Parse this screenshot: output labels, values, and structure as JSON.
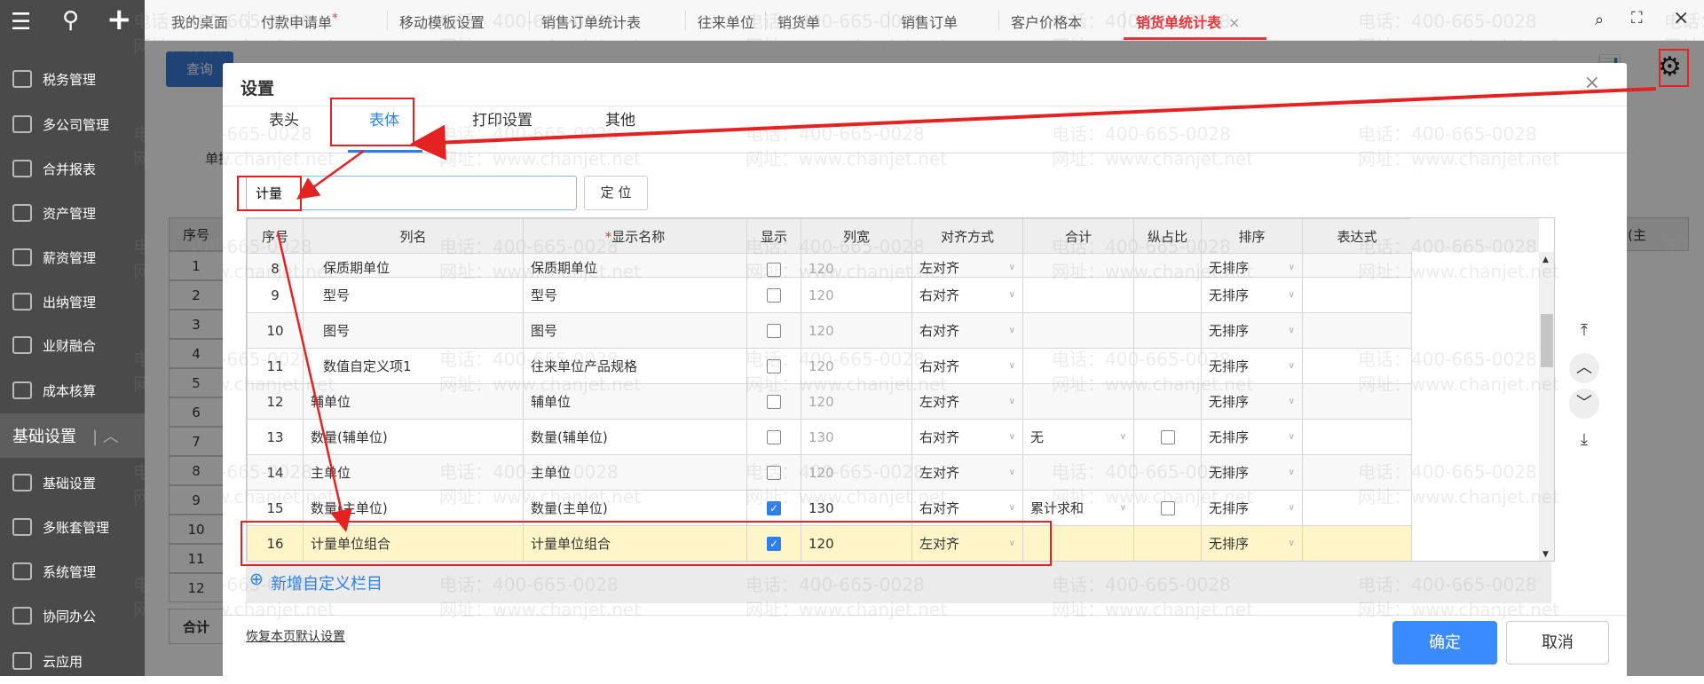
{
  "sidebar": {
    "top_icons": [
      "menu-icon",
      "search-icon",
      "plus-icon"
    ],
    "items": [
      "税务管理",
      "多公司管理",
      "合并报表",
      "资产管理",
      "薪资管理",
      "出纳管理",
      "业财融合",
      "成本核算"
    ],
    "group": "基础设置",
    "group_items": [
      "基础设置",
      "多账套管理",
      "系统管理",
      "协同办公",
      "云应用"
    ]
  },
  "tabs": [
    {
      "label": "我的桌面"
    },
    {
      "label": "付款申请单",
      "mark": "*"
    },
    {
      "label": "移动模板设置"
    },
    {
      "label": "销售订单统计表"
    },
    {
      "label": "往来单位"
    },
    {
      "label": "销货单"
    },
    {
      "label": "销售订单"
    },
    {
      "label": "客户价格本"
    },
    {
      "label": "销货单统计表",
      "close": "×"
    }
  ],
  "background": {
    "query_button": "查询",
    "label": "单据",
    "seq_header": "序号",
    "right_header": "数量(主",
    "rows": [
      "1",
      "2",
      "3",
      "4",
      "5",
      "6",
      "7",
      "8",
      "9",
      "10",
      "11",
      "12"
    ],
    "total": "合计"
  },
  "modal": {
    "title": "设置",
    "close": "×",
    "tabs": [
      "表头",
      "表体",
      "打印设置",
      "其他"
    ],
    "search_value": "计量",
    "locate_button": "定 位",
    "columns": [
      "序号",
      "列名",
      "显示名称",
      "显示",
      "列宽",
      "对齐方式",
      "合计",
      "纵占比",
      "排序",
      "表达式"
    ],
    "required_mark": "*",
    "rows": [
      {
        "seq": "8",
        "col": "保质期单位",
        "display": "保质期单位",
        "show": false,
        "width": "120",
        "align": "左对齐",
        "total": "",
        "ratio": null,
        "sort": "无排序"
      },
      {
        "seq": "9",
        "col": "型号",
        "display": "型号",
        "show": false,
        "width": "120",
        "align": "右对齐",
        "total": "",
        "ratio": null,
        "sort": "无排序"
      },
      {
        "seq": "10",
        "col": "图号",
        "display": "图号",
        "show": false,
        "width": "120",
        "align": "右对齐",
        "total": "",
        "ratio": null,
        "sort": "无排序"
      },
      {
        "seq": "11",
        "col": "数值自定义项1",
        "display": "往来单位产品规格",
        "show": false,
        "width": "120",
        "align": "右对齐",
        "total": "",
        "ratio": null,
        "sort": "无排序"
      },
      {
        "seq": "12",
        "col": "辅单位",
        "display": "辅单位",
        "show": false,
        "width": "120",
        "align": "左对齐",
        "total": "",
        "ratio": null,
        "sort": "无排序"
      },
      {
        "seq": "13",
        "col": "数量(辅单位)",
        "display": "数量(辅单位)",
        "show": false,
        "width": "130",
        "align": "右对齐",
        "total": "无",
        "ratio": false,
        "sort": "无排序"
      },
      {
        "seq": "14",
        "col": "主单位",
        "display": "主单位",
        "show": false,
        "width": "120",
        "align": "左对齐",
        "total": "",
        "ratio": null,
        "sort": "无排序"
      },
      {
        "seq": "15",
        "col": "数量(主单位)",
        "display": "数量(主单位)",
        "show": true,
        "width": "130",
        "align": "右对齐",
        "total": "累计求和",
        "ratio": false,
        "sort": "无排序"
      },
      {
        "seq": "16",
        "col": "计量单位组合",
        "display": "计量单位组合",
        "show": true,
        "width": "120",
        "align": "左对齐",
        "total": "",
        "ratio": null,
        "sort": "无排序"
      }
    ],
    "add_custom": "新增自定义栏目",
    "restore_default": "恢复本页默认设置",
    "ok": "确定",
    "cancel": "取消"
  },
  "watermark": "电话：400-665-0028\n网址：www.chanjet.net",
  "colors": {
    "accent": "#2b7ff1",
    "active_tab": "#e8333a",
    "highlight_row": "#fff5c8",
    "annotation": "#e52222"
  }
}
